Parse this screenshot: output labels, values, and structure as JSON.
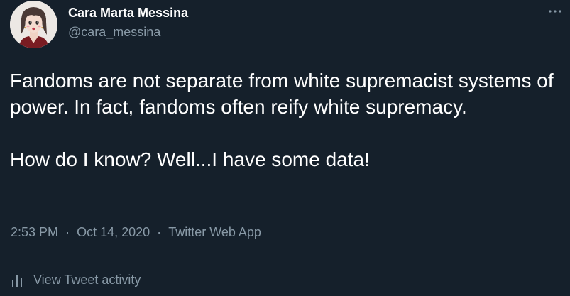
{
  "author": {
    "display_name": "Cara Marta Messina",
    "handle": "@cara_messina",
    "avatar_icon": "avatar-illustration"
  },
  "tweet": {
    "paragraphs": [
      "Fandoms are not separate from white supremacist systems of power. In fact, fandoms often reify white supremacy.",
      "How do I know? Well...I have some data!"
    ]
  },
  "meta": {
    "time": "2:53 PM",
    "date": "Oct 14, 2020",
    "source": "Twitter Web App",
    "separator": "·"
  },
  "actions": {
    "more_icon": "more-dots-icon",
    "activity_label": "View Tweet activity",
    "activity_icon": "bar-chart-icon"
  },
  "colors": {
    "background": "#15202b",
    "text": "#ffffff",
    "secondary_text": "#8899a6",
    "divider": "#38444d"
  }
}
